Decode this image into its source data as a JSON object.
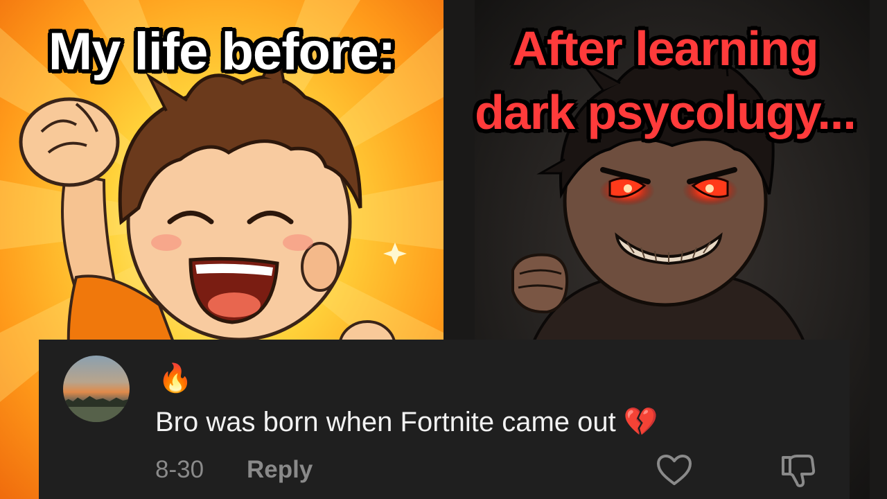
{
  "meme": {
    "left_caption": "My life before:",
    "right_caption_line1": "After learning",
    "right_caption_line2": "dark psycolugy..."
  },
  "comment": {
    "emoji": "🔥",
    "text": "Bro was born when Fortnite came out 💔",
    "date": "8-30",
    "reply_label": "Reply"
  },
  "icons": {
    "like": "heart-outline-icon",
    "dislike": "thumbs-down-outline-icon"
  },
  "colors": {
    "left_caption": "#ffffff",
    "right_caption": "#ff3b3b",
    "card_background": "#1f1f1f",
    "meta_text": "#8a8a8a"
  }
}
